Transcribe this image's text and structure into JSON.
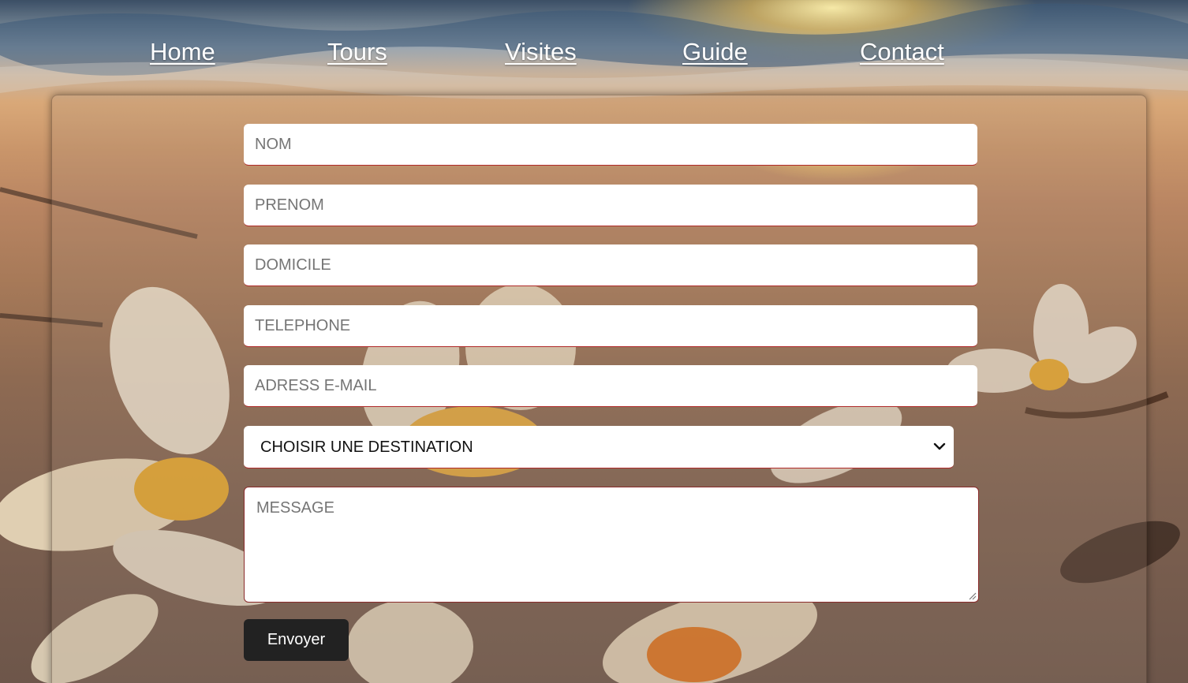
{
  "nav": {
    "items": [
      {
        "label": "Home"
      },
      {
        "label": "Tours"
      },
      {
        "label": "Visites"
      },
      {
        "label": "Guide"
      },
      {
        "label": "Contact"
      }
    ]
  },
  "form": {
    "nom": {
      "placeholder": "NOM",
      "value": ""
    },
    "prenom": {
      "placeholder": "PRENOM",
      "value": ""
    },
    "domicile": {
      "placeholder": "DOMICILE",
      "value": ""
    },
    "telephone": {
      "placeholder": "TELEPHONE",
      "value": ""
    },
    "email": {
      "placeholder": "ADRESS E-MAIL",
      "value": ""
    },
    "destination": {
      "selected": "CHOISIR UNE DESTINATION"
    },
    "message": {
      "placeholder": "MESSAGE"
    },
    "submit_label": "Envoyer"
  },
  "icons": {
    "select_arrow": "chevron-down-icon",
    "textarea_grip": "resize-grip-icon"
  },
  "colors": {
    "button_bg": "#222222",
    "field_accent": "#b02a2a",
    "nav_text": "#ffffff"
  }
}
